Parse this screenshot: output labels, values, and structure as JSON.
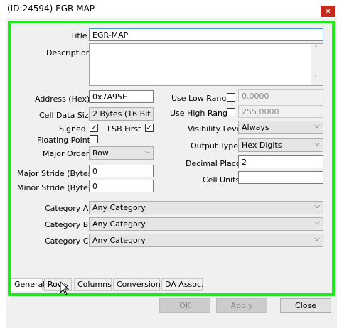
{
  "window": {
    "title": "(ID:24594) EGR-MAP",
    "close_glyph": "×"
  },
  "fields": {
    "title": {
      "label": "Title",
      "value": "EGR-MAP"
    },
    "description": {
      "label": "Description",
      "value": ""
    },
    "address": {
      "label": "Address (Hex)",
      "value": "0x7A95E"
    },
    "cell_data_size": {
      "label": "Cell Data Size",
      "value": "2 Bytes (16 Bit"
    },
    "signed": {
      "label": "Signed",
      "checked": true
    },
    "lsb_first": {
      "label": "LSB First",
      "checked": true
    },
    "floating_point": {
      "label": "Floating Point",
      "checked": false
    },
    "major_order": {
      "label": "Major Order",
      "value": "Row"
    },
    "major_stride": {
      "label": "Major Stride (Bytes)",
      "value": "0"
    },
    "minor_stride": {
      "label": "Minor Stride (Bytes)",
      "value": "0"
    },
    "use_low_range": {
      "label": "Use Low Range",
      "checked": false,
      "value": "0.0000"
    },
    "use_high_range": {
      "label": "Use High Range",
      "checked": false,
      "value": "255.0000"
    },
    "visibility_level": {
      "label": "Visibility Level",
      "value": "Always"
    },
    "output_type": {
      "label": "Output Type",
      "value": "Hex Digits"
    },
    "decimal_places": {
      "label": "Decimal Places",
      "value": "2"
    },
    "cell_units": {
      "label": "Cell Units",
      "value": ""
    },
    "category_a": {
      "label": "Category A",
      "value": "Any Category"
    },
    "category_b": {
      "label": "Category B",
      "value": "Any Category"
    },
    "category_c": {
      "label": "Category C",
      "value": "Any Category"
    }
  },
  "tabs": [
    {
      "label": "General",
      "active": true
    },
    {
      "label": "Rows",
      "active": false
    },
    {
      "label": "Columns",
      "active": false
    },
    {
      "label": "Conversion",
      "active": false
    },
    {
      "label": "DA Assoc.",
      "active": false
    }
  ],
  "buttons": {
    "ok": "OK",
    "apply": "Apply",
    "close": "Close"
  },
  "icons": {
    "check": "✓",
    "chevron": "⌵",
    "scroll_up": "˄",
    "scroll_down": "˅"
  },
  "colors": {
    "highlight_frame": "#1de91d",
    "close_button": "#c42b1c",
    "dialog_bg": "#f0f0f0"
  }
}
